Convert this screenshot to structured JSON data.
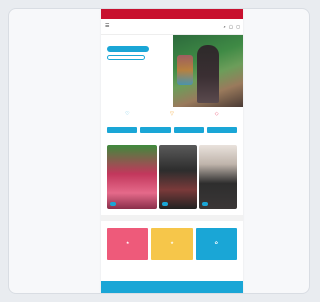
{
  "promo": {
    "text": ""
  },
  "header": {
    "menu_icon": "hamburger-icon",
    "logo_part1": "",
    "logo_part2": "",
    "icons": [
      "search-icon",
      "user-icon",
      "bag-icon"
    ]
  },
  "hero": {
    "kicker": "",
    "title": "",
    "subtitle": "",
    "primary_button": "",
    "secondary_button": ""
  },
  "features": [
    {
      "icon": "heart-icon",
      "label": ""
    },
    {
      "icon": "tshirt-icon",
      "label": ""
    },
    {
      "icon": "box-icon",
      "label": ""
    }
  ],
  "categories": [
    "",
    "",
    "",
    ""
  ],
  "looks_section": {
    "title": "",
    "items": [
      {
        "caption": "",
        "button": ""
      },
      {
        "caption": "",
        "button": ""
      },
      {
        "caption": "",
        "button": ""
      }
    ]
  },
  "quick": {
    "title": "",
    "tiles": [
      {
        "glyph": "★",
        "label": ""
      },
      {
        "glyph": "★",
        "label": ""
      },
      {
        "glyph": "✿",
        "label": ""
      }
    ]
  },
  "cookie": {
    "text": "",
    "buttons": [
      "",
      "",
      ""
    ]
  },
  "colors": {
    "promo_bar": "#c8102e",
    "accent": "#1aa6d6",
    "tile_pink": "#ee5a7a",
    "tile_yellow": "#f6c64a",
    "tile_blue": "#1aa6d6"
  }
}
